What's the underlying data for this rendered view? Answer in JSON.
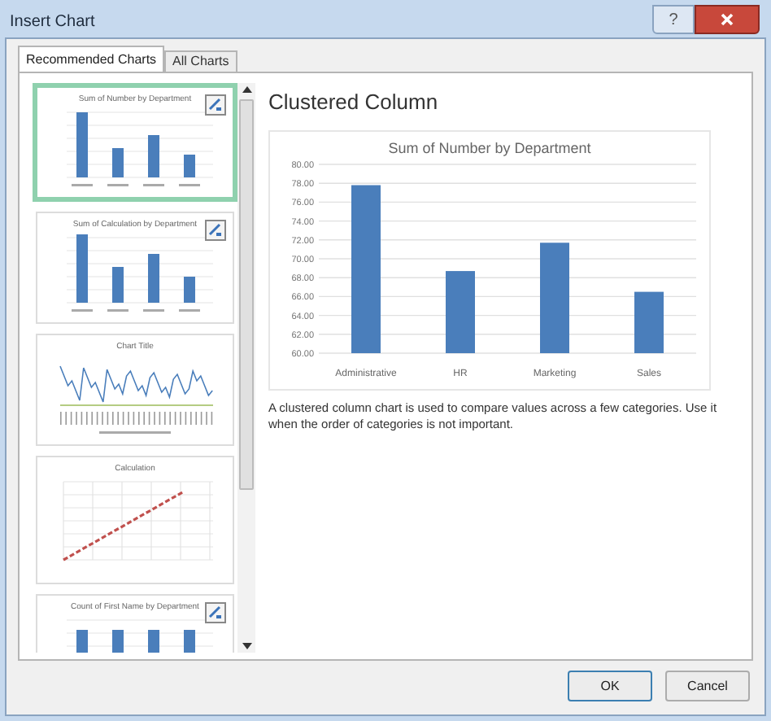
{
  "window": {
    "title": "Insert Chart",
    "help": "?"
  },
  "tabs": [
    {
      "label": "Recommended Charts",
      "selected": true
    },
    {
      "label": "All Charts",
      "selected": false
    }
  ],
  "thumbnails": [
    {
      "title": "Sum of Number by Department",
      "kind": "column",
      "selected": true,
      "quick_layout": true
    },
    {
      "title": "Sum of Calculation by Department",
      "kind": "column",
      "selected": false,
      "quick_layout": true
    },
    {
      "title": "Chart Title",
      "kind": "line",
      "selected": false,
      "quick_layout": false
    },
    {
      "title": "Calculation",
      "kind": "scatter",
      "selected": false,
      "quick_layout": false
    },
    {
      "title": "Count of First Name by Department",
      "kind": "flat",
      "selected": false,
      "quick_layout": true
    }
  ],
  "preview": {
    "heading": "Clustered Column",
    "chart_data": {
      "type": "bar",
      "title": "Sum of Number by Department",
      "categories": [
        "Administrative",
        "HR",
        "Marketing",
        "Sales"
      ],
      "series": [
        {
          "color": "#4a7ebb",
          "values": [
            77.8,
            68.7,
            71.7,
            66.5
          ]
        }
      ],
      "grid": true,
      "ylim": [
        60,
        80
      ],
      "yticks": [
        {
          "value": 60,
          "label": "60.00"
        },
        {
          "value": 62,
          "label": "62.00"
        },
        {
          "value": 64,
          "label": "64.00"
        },
        {
          "value": 66,
          "label": "66.00"
        },
        {
          "value": 68,
          "label": "68.00"
        },
        {
          "value": 70,
          "label": "70.00"
        },
        {
          "value": 72,
          "label": "72.00"
        },
        {
          "value": 74,
          "label": "74.00"
        },
        {
          "value": 76,
          "label": "76.00"
        },
        {
          "value": 78,
          "label": "78.00"
        },
        {
          "value": 80,
          "label": "80.00"
        }
      ]
    },
    "description": "A clustered column chart is used to compare values across a few categories. Use it when the order of categories is not important."
  },
  "buttons": [
    "OK",
    "Cancel"
  ]
}
